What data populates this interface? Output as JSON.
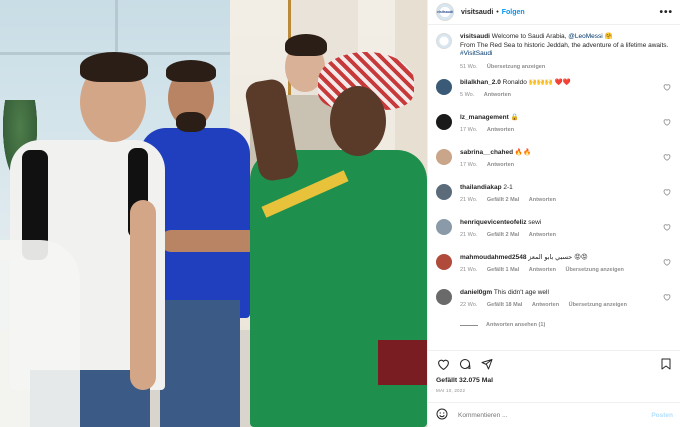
{
  "colors": {
    "link_blue": "#0095f6",
    "heart_red": "#ed4956",
    "muted": "#8e8e8e"
  },
  "header": {
    "username": "visitsaudi",
    "dot": "•",
    "follow_label": "Folgen",
    "more_icon": "more-horizontal-icon",
    "logo_text": "visitsaudi"
  },
  "caption": {
    "username": "visitsaudi",
    "text_1": "Welcome to Saudi Arabia, ",
    "mention": "@LeoMessi",
    "text_2": " 🤗",
    "line_2": "From The Red Sea to historic Jeddah, the adventure of a lifetime awaits.",
    "hashtag": "#VisitSaudi",
    "time": "51 Wo.",
    "translate": "Übersetzung anzeigen"
  },
  "comments": [
    {
      "username": "bilalkhan_2.0",
      "text": "Ronaldo 🙌🙌🙌 ❤️❤️",
      "time": "5 Wo.",
      "likes": "",
      "reply": "Antworten",
      "translate": "",
      "avatar_color": "#3a5a78"
    },
    {
      "username": "lz_management",
      "text": "🔒",
      "time": "17 Wo.",
      "likes": "",
      "reply": "Antworten",
      "translate": "",
      "avatar_color": "#1a1a1a"
    },
    {
      "username": "sabrina__chahed",
      "text": "🔥🔥",
      "time": "17 Wo.",
      "likes": "",
      "reply": "Antworten",
      "translate": "",
      "avatar_color": "#c9a58a"
    },
    {
      "username": "thailandiakap",
      "text": "2-1",
      "time": "21 Wo.",
      "likes": "Gefällt 2 Mal",
      "reply": "Antworten",
      "translate": "",
      "avatar_color": "#5b6b7a"
    },
    {
      "username": "henriquevicenteofeliz",
      "text": "sewi",
      "time": "21 Wo.",
      "likes": "Gefällt 2 Mal",
      "reply": "Antworten",
      "translate": "",
      "avatar_color": "#8a9aa8"
    },
    {
      "username": "mahmoudahmed2548",
      "text": "حسبي بابو المعز 😡😡",
      "time": "21 Wo.",
      "likes": "Gefällt 1 Mal",
      "reply": "Antworten",
      "translate": "Übersetzung anzeigen",
      "avatar_color": "#b04a3a"
    },
    {
      "username": "daniel0gm",
      "text": "This didn't age well",
      "time": "22 Wo.",
      "likes": "Gefällt 18 Mal",
      "reply": "Antworten",
      "translate": "Übersetzung anzeigen",
      "avatar_color": "#6a6a6a"
    }
  ],
  "view_replies": "Antworten ansehen (1)",
  "actions": {
    "likes": "Gefällt 32.075 Mal",
    "date": "MAI 10, 2022"
  },
  "add_comment": {
    "placeholder": "Kommentieren ...",
    "post_label": "Posten"
  }
}
